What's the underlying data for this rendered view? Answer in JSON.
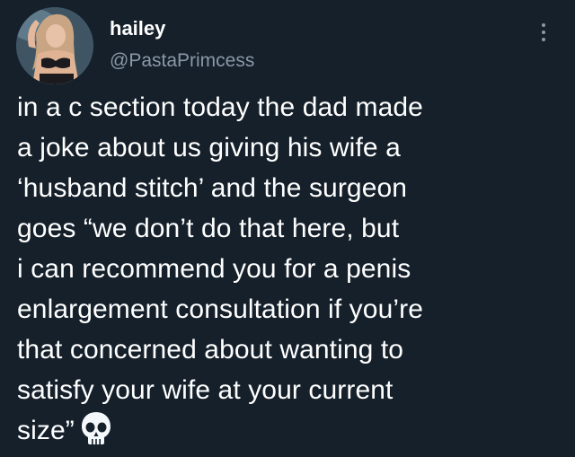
{
  "tweet": {
    "author_name": "hailey",
    "author_handle": "@PastaPrimcess",
    "avatar_icon": "profile-photo",
    "more_icon": "vertical-ellipsis-icon",
    "text_lines": [
      "in a c section today the dad made",
      "a joke about us giving his wife a",
      "‘husband stitch’ and the surgeon",
      "goes “we don’t do that here, but",
      "i can recommend you for a penis",
      "enlargement consultation if you’re",
      "that concerned about wanting to",
      "satisfy your wife at your current",
      "size”"
    ],
    "trailing_emoji": "skull-emoji"
  },
  "colors": {
    "background": "#15202b",
    "text_primary": "#ffffff",
    "text_secondary": "#8b98a5"
  }
}
